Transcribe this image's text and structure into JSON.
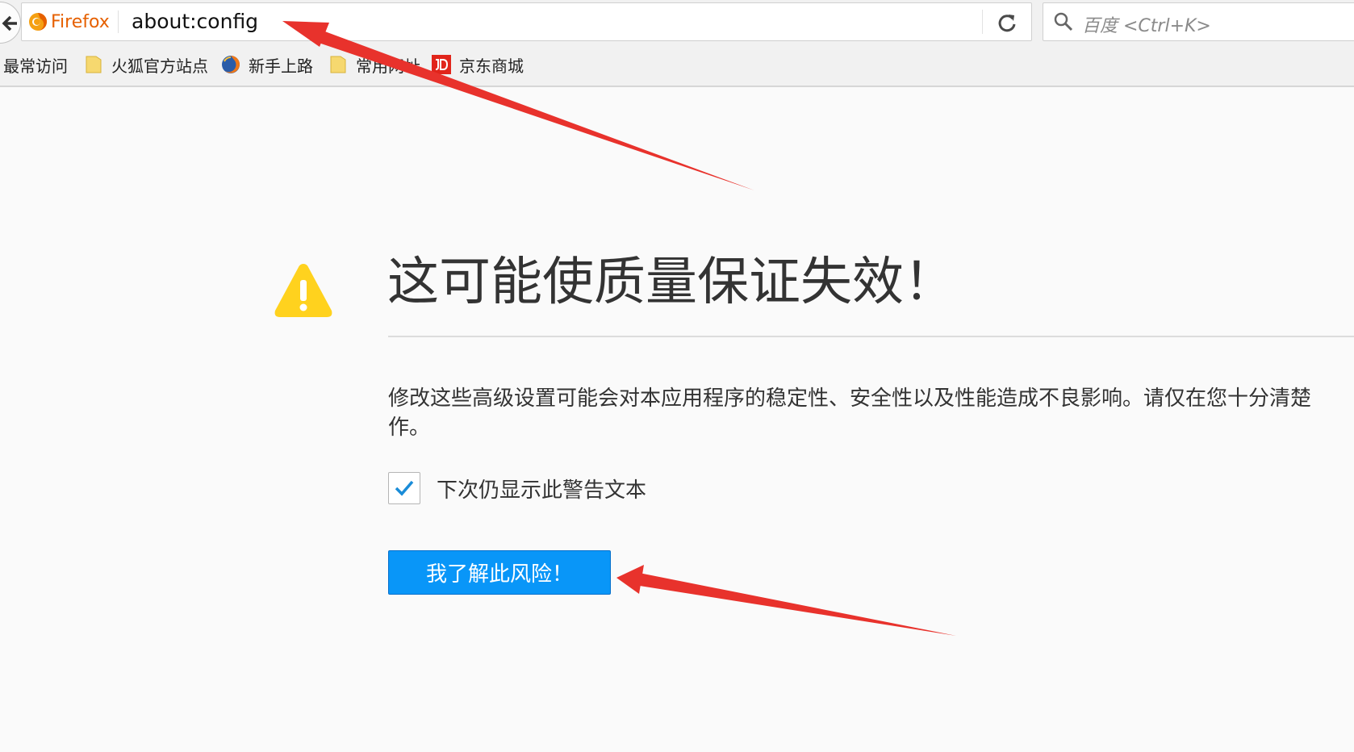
{
  "navbar": {
    "identity_label": "Firefox",
    "url": "about:config",
    "search_placeholder": "百度 <Ctrl+K>"
  },
  "bookmarks": [
    {
      "label": "最常访问",
      "icon": "none"
    },
    {
      "label": "火狐官方站点",
      "icon": "folder-icon"
    },
    {
      "label": "新手上路",
      "icon": "firefox-icon"
    },
    {
      "label": "常用网址",
      "icon": "folder-icon"
    },
    {
      "label": "京东商城",
      "icon": "jd-icon"
    }
  ],
  "warning": {
    "title": "这可能使质量保证失效！",
    "description_line1": "修改这些高级设置可能会对本应用程序的稳定性、安全性以及性能造成不良影响。请仅在您十分清楚",
    "description_line2": "作。",
    "checkbox_label": "下次仍显示此警告文本",
    "checkbox_checked": true,
    "accept_button": "我了解此风险！"
  },
  "colors": {
    "accent": "#0996f8",
    "warning_yellow": "#ffd21e",
    "annotation_red": "#e8322c",
    "firefox_orange": "#e66000"
  }
}
